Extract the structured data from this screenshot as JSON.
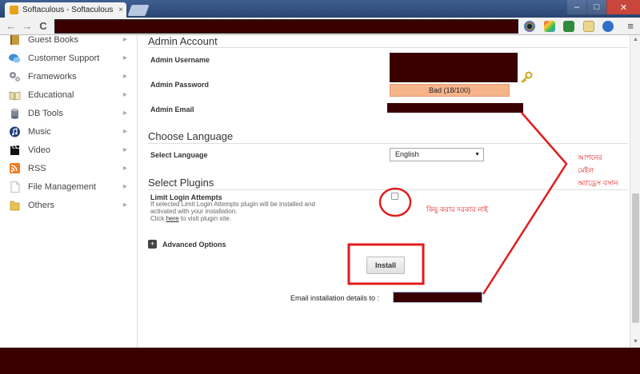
{
  "browser": {
    "tab_title": "Softaculous - Softaculous",
    "tab_close": "×",
    "window_controls": [
      "–",
      "□",
      "✕"
    ],
    "nav": {
      "back": "←",
      "forward": "→",
      "reload": "C"
    },
    "menu": "≡"
  },
  "sidebar": {
    "items": [
      {
        "label": "Guest Books",
        "icon": "book-icon",
        "arrow": "▸"
      },
      {
        "label": "Customer Support",
        "icon": "chat-bubbles-icon",
        "arrow": "▸"
      },
      {
        "label": "Frameworks",
        "icon": "gears-icon",
        "arrow": "▸"
      },
      {
        "label": "Educational",
        "icon": "open-book-icon",
        "arrow": "▸"
      },
      {
        "label": "DB Tools",
        "icon": "database-icon",
        "arrow": "▸"
      },
      {
        "label": "Music",
        "icon": "music-note-icon",
        "arrow": "▸"
      },
      {
        "label": "Video",
        "icon": "clapperboard-icon",
        "arrow": "▸"
      },
      {
        "label": "RSS",
        "icon": "rss-icon",
        "arrow": "▸"
      },
      {
        "label": "File Management",
        "icon": "file-icon",
        "arrow": "▸"
      },
      {
        "label": "Others",
        "icon": "folder-icon",
        "arrow": "▸"
      }
    ]
  },
  "main": {
    "admin_section_title": "Admin Account",
    "admin_username_label": "Admin Username",
    "admin_password_label": "Admin Password",
    "password_strength": "Bad (18/100)",
    "admin_email_label": "Admin Email",
    "language_section_title": "Choose Language",
    "select_language_label": "Select Language",
    "language_value": "English",
    "language_arrow": "▼",
    "plugins_section_title": "Select Plugins",
    "plugin_name": "Limit Login Attempts",
    "plugin_desc_line1": "If selected Limit Login Attempts plugin will be installed and",
    "plugin_desc_line2": "activated with your installation.",
    "plugin_desc_click": "Click",
    "plugin_desc_here": "here",
    "plugin_desc_rest": "to visit plugin site.",
    "advanced_icon": "+",
    "advanced_label": "Advanced Options",
    "install_label": "Install",
    "email_install_label": "Email installation details to :"
  },
  "annotations": {
    "note_right_line1": "আপনের",
    "note_right_line2": "মেইল",
    "note_right_line3": "অ্যাড্রেস বসান",
    "note_plugin": "কিছু করার দরকার নাই",
    "color": "#e21c1c"
  },
  "scrollbar": {
    "up": "▲",
    "down": "▼"
  }
}
